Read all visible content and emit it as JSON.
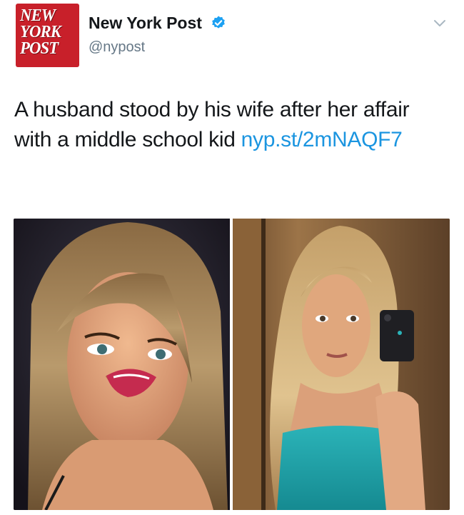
{
  "account": {
    "display_name": "New York Post",
    "handle": "@nypost",
    "verified": true,
    "avatar_logo_lines": [
      "NEW",
      "YORK",
      "POST"
    ],
    "avatar_color": "#c8202a"
  },
  "tweet": {
    "text": "A husband stood by his wife after her affair with a middle school kid ",
    "link_text": "nyp.st/2mNAQF7",
    "link_color": "#1b95e0"
  },
  "media": {
    "photo_count": 2
  },
  "icons": {
    "verified": "verified-badge-icon",
    "menu": "chevron-down-icon"
  }
}
